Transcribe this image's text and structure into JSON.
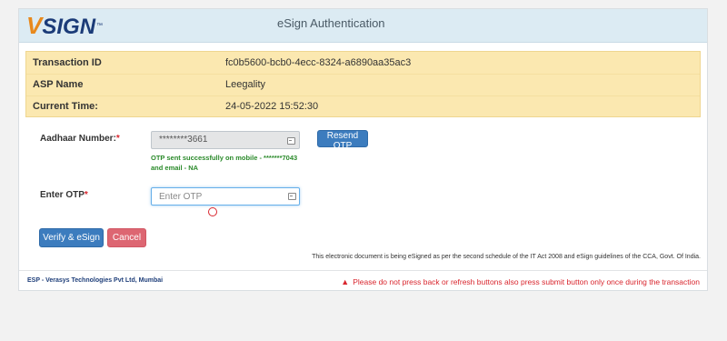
{
  "header": {
    "logo_text": "VSIGN",
    "logo_tm": "™",
    "title": "eSign Authentication"
  },
  "info": {
    "rows": [
      {
        "label": "Transaction ID",
        "value": "fc0b5600-bcb0-4ecc-8324-a6890aa35ac3"
      },
      {
        "label": "ASP Name",
        "value": "Leegality"
      },
      {
        "label": "Current Time:",
        "value": "24-05-2022 15:52:30"
      }
    ]
  },
  "form": {
    "aadhaar_label": "Aadhaar Number:",
    "aadhaar_value": "********3661",
    "resend_otp_label": "Resend OTP",
    "otp_message_line1": "OTP sent successfully on mobile - *******7043",
    "otp_message_line2": "and email - NA",
    "otp_label": "Enter OTP",
    "otp_placeholder": "Enter OTP",
    "required_mark": "*",
    "verify_label": "Verify & eSign",
    "cancel_label": "Cancel"
  },
  "disclaimer": "This electronic document is being eSigned as per the second schedule of the IT Act 2008 and eSign guidelines of the CCA, Govt. Of India.",
  "footer": {
    "esp_text": "ESP - Verasys Technologies Pvt Ltd, Mumbai",
    "warning_text": "Please do not press back or refresh buttons also press submit button only once during the transaction",
    "warning_icon": "warning-triangle-icon"
  },
  "colors": {
    "header_bg": "#dcebf3",
    "info_bg": "#fbe8b0",
    "primary_button": "#3c7cbe",
    "cancel_button": "#dd6672",
    "success_text": "#2a8a2a",
    "warning_text": "#d9262e",
    "logo_orange": "#e8891c",
    "logo_blue": "#1b3b78"
  }
}
